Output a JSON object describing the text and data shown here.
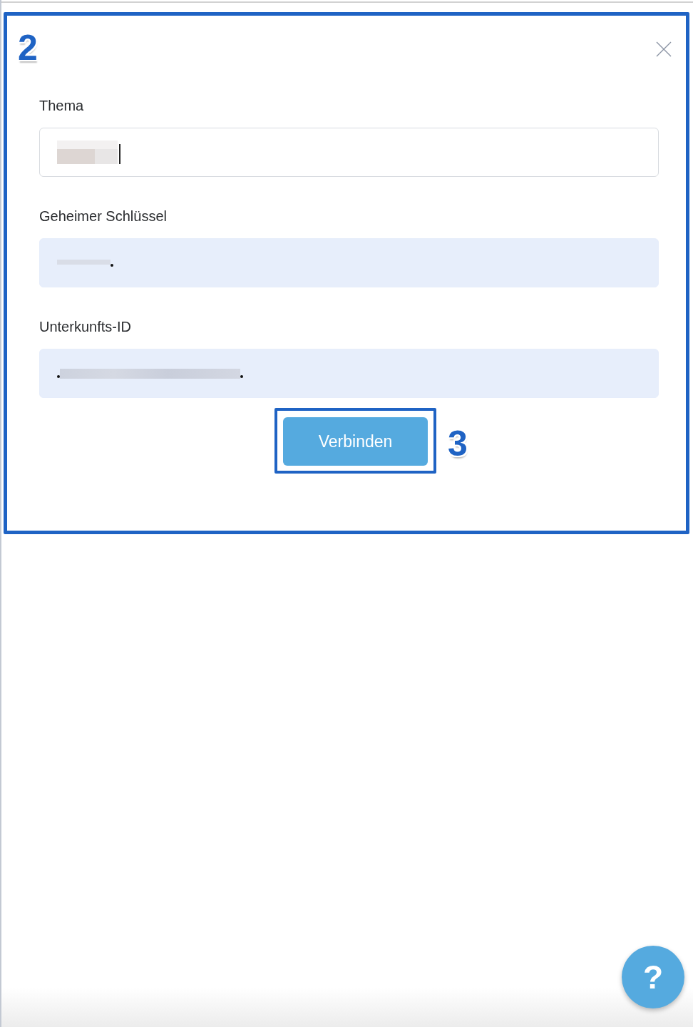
{
  "dialog": {
    "highlighted": true,
    "step_marker": "2",
    "fields": [
      {
        "label": "Thema",
        "value_redacted": true,
        "focused": true,
        "autofilled": false
      },
      {
        "label": "Geheimer Schlüssel",
        "value_redacted": true,
        "focused": false,
        "autofilled": true
      },
      {
        "label": "Unterkunfts-ID",
        "value_redacted": true,
        "focused": false,
        "autofilled": true
      }
    ],
    "connect_button": {
      "label": "Verbinden",
      "highlighted": true,
      "step_marker": "3"
    }
  },
  "help_button": {
    "label": "?"
  }
}
